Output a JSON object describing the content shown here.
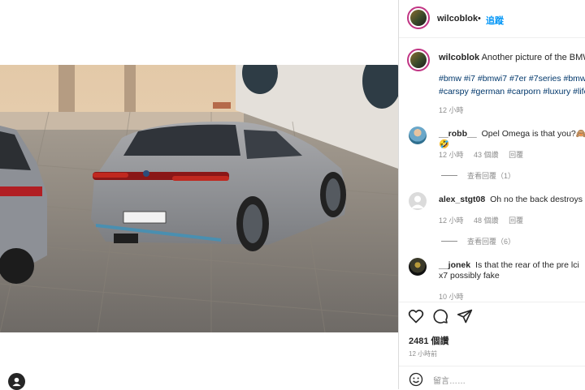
{
  "post": {
    "username": "wilcoblok",
    "separator": "•",
    "follow_label": "追蹤"
  },
  "caption": {
    "username": "wilcoblok",
    "text": "Another picture of the BMW",
    "hashtags": "#bmw #i7 #bmwi7 #7er #7series #bmw #carspy #german #carporn #luxury #life",
    "time": "12 小時"
  },
  "comments": [
    {
      "username": "__robb__",
      "text": "Opel Omega is that you?🙈🤣",
      "time": "12 小時",
      "likes": "43 個讚",
      "reply": "回覆",
      "view_replies": "查看回覆（1）"
    },
    {
      "username": "alex_stgt08",
      "text": "Oh no the back destroys ev",
      "time": "12 小時",
      "likes": "48 個讚",
      "reply": "回覆",
      "view_replies": "查看回覆（6）"
    },
    {
      "username": "__jonek",
      "text": "Is that the rear of the pre lci x7 possibly fake",
      "time": "10 小時"
    }
  ],
  "likes_count": "2481 個讚",
  "post_time": "12 小時前",
  "comment_placeholder": "留言……",
  "icons": [
    "heart-icon",
    "comment-icon",
    "share-icon",
    "emoji-icon",
    "user-icon"
  ],
  "colors": {
    "link": "#00376b",
    "follow": "#0095f6",
    "muted": "#8e8e8e",
    "text": "#262626"
  }
}
